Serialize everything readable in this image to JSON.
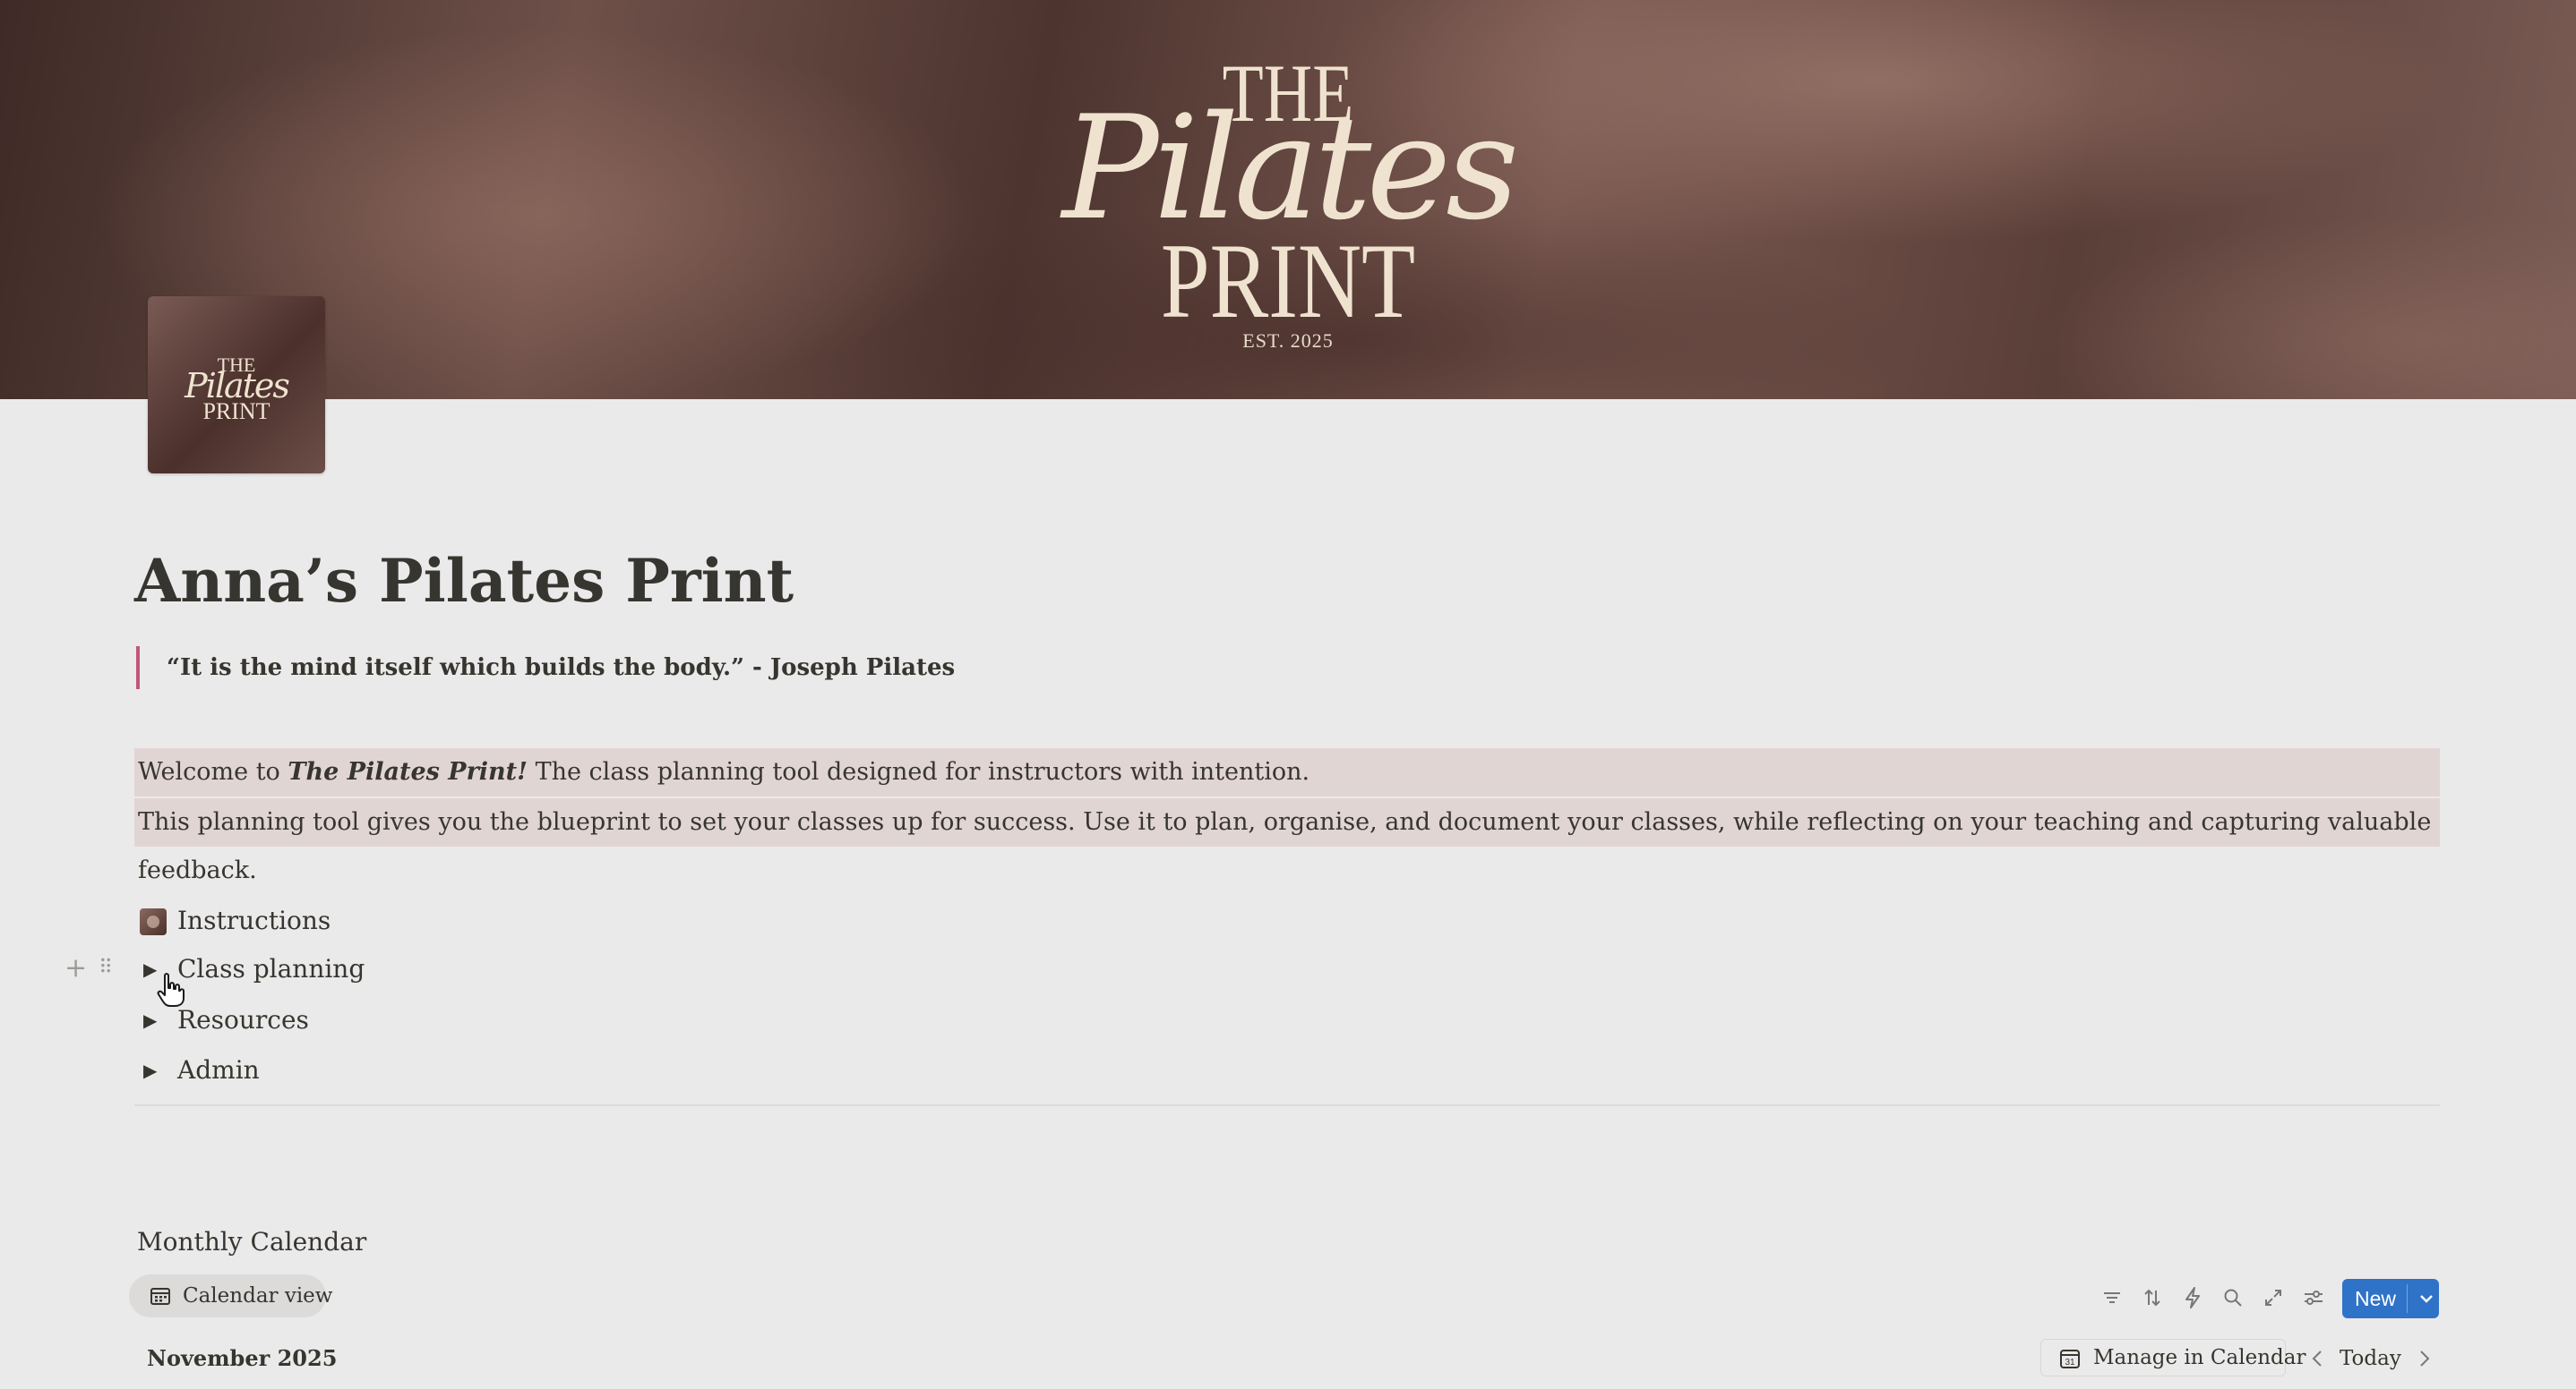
{
  "cover": {
    "logo_line1": "THE",
    "logo_script": "Pilates",
    "logo_line3": "PRINT",
    "logo_est": "EST. 2025"
  },
  "page": {
    "title": "Anna’s Pilates Print",
    "quote": "“It is the mind itself which builds the body.” - Joseph Pilates",
    "callout1": {
      "before": "Welcome to ",
      "emphasis": "The Pilates Print!",
      "after": " The class planning tool designed for instructors with intention."
    },
    "callout2": "This planning tool gives you the blueprint to set your classes up for success. Use it to plan, organise, and document your classes, while reflecting on your teaching and capturing valuable feedback."
  },
  "links": {
    "instructions": "Instructions",
    "toggles": [
      "Class planning",
      "Resources",
      "Admin"
    ]
  },
  "database": {
    "title": "Monthly Calendar",
    "view_label": "Calendar view",
    "new_label": "New",
    "month_label": "November 2025",
    "manage_label": "Manage in Calendar",
    "today_label": "Today"
  },
  "icons": [
    "filter-icon",
    "sort-icon",
    "automation-icon",
    "search-icon",
    "expand-icon",
    "settings-icon",
    "chevron-down-icon",
    "calendar-icon",
    "chevron-left-icon",
    "chevron-right-icon"
  ],
  "colors": {
    "accent_blue": "#2f73c8",
    "quote_bar": "#c0587a",
    "callout_bg": "#e1d5d4",
    "page_bg": "#ebeaea",
    "text": "#37352f"
  }
}
